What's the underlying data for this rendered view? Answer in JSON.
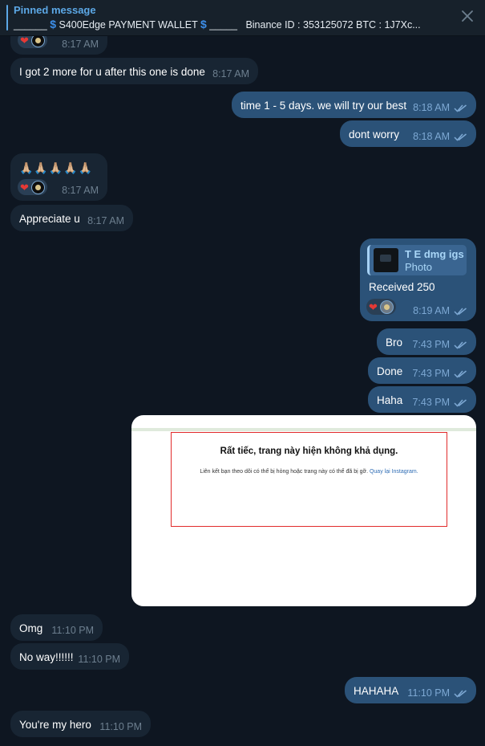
{
  "pinned": {
    "title": "Pinned message",
    "line1": "______",
    "dollar": "$",
    "wallet": "S400Edge PAYMENT WALLET",
    "line2": "_____",
    "rest": "Binance ID : 353125072  BTC : 1J7Xc..."
  },
  "icons": {
    "close": "close-icon",
    "read": "double-check-icon",
    "heart": "heart-icon",
    "avatar": "avatar-icon"
  },
  "messages": {
    "m0": {
      "time": "8:17 AM"
    },
    "m1": {
      "text": "I got 2 more for u after this one is done",
      "time": "8:17 AM"
    },
    "m2": {
      "text": "time 1 - 5 days. we will try our best",
      "time": "8:18 AM"
    },
    "m3": {
      "text": "dont worry",
      "time": "8:18 AM"
    },
    "m4": {
      "text": "🙏🏼🙏🏼🙏🏼🙏🏼🙏🏼",
      "time": "8:17 AM"
    },
    "m5": {
      "text": "Appreciate u",
      "time": "8:17 AM"
    },
    "m6": {
      "reply_name": "T E dmg igs",
      "reply_type": "Photo",
      "text": "Received 250",
      "time": "8:19 AM"
    },
    "m7": {
      "text": "Bro",
      "time": "7:43 PM"
    },
    "m8": {
      "text": "Done",
      "time": "7:43 PM"
    },
    "m9": {
      "text": "Haha",
      "time": "7:43 PM"
    },
    "m11": {
      "text": "Omg",
      "time": "11:10 PM"
    },
    "m12": {
      "text": "No way!!!!!!",
      "time": "11:10 PM"
    },
    "m13": {
      "text": "HAHAHA",
      "time": "11:10 PM"
    },
    "m14": {
      "text": "You're my hero",
      "time": "11:10 PM"
    }
  },
  "photo": {
    "title": "Rất tiếc, trang này hiện không khả dụng.",
    "body": "Liên kết bạn theo dõi có thể bị hỏng hoặc trang này có thể đã bị gỡ.",
    "link": "Quay lại Instagram."
  },
  "colors": {
    "background": "#0e1621",
    "incoming": "#182533",
    "outgoing": "#2b5278",
    "accent": "#5ca8e6"
  }
}
